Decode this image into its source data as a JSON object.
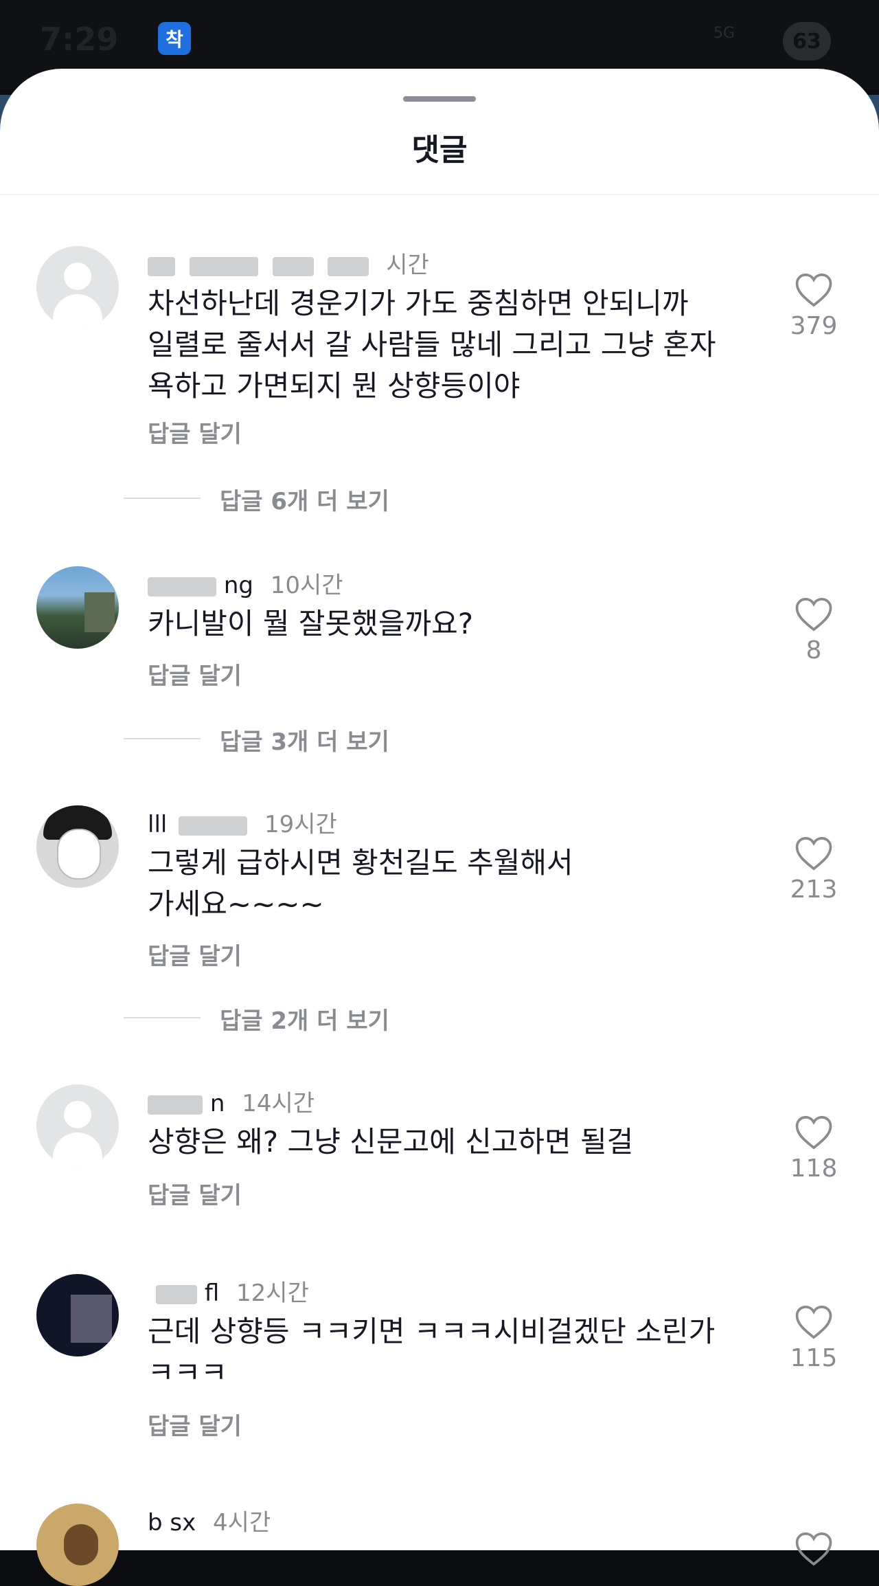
{
  "status_bar": {
    "time": "7:29",
    "notif_badge": "착",
    "network": "5G",
    "battery": "63"
  },
  "sheet": {
    "title": "댓글"
  },
  "reply_label": "답글 달기",
  "comments": [
    {
      "username_visible": "",
      "time": "시간",
      "text_lines": [
        "차선하난데  경운기가 가도 중침하면 안되니까",
        "일렬로 줄서서 갈 사람들 많네 그리고 그냥 혼자",
        "욕하고 가면되지 뭔 상향등이야"
      ],
      "likes": "379",
      "more_replies": "답글 6개 더 보기",
      "avatar": "default-avatar"
    },
    {
      "username_visible": "ng",
      "time": "10시간",
      "text_lines": [
        "카니발이 뭘 잘못했을까요?"
      ],
      "likes": "8",
      "more_replies": "답글 3개 더 보기",
      "avatar": "sky-photo-avatar"
    },
    {
      "username_visible": "lll",
      "time": "19시간",
      "text_lines": [
        "그렇게 급하시면 황천길도 추월해서",
        "가세요~~~~"
      ],
      "likes": "213",
      "more_replies": "답글 2개 더 보기",
      "avatar": "mask-photo-avatar"
    },
    {
      "username_visible": "n",
      "time": "14시간",
      "text_lines": [
        "상향은 왜? 그냥 신문고에 신고하면 될걸"
      ],
      "likes": "118",
      "more_replies": "",
      "avatar": "default-avatar"
    },
    {
      "username_visible": "fl",
      "time": "12시간",
      "text_lines": [
        "근데 상향등 ㅋㅋ키면 ㅋㅋㅋ시비걸겠단 소린가",
        "ㅋㅋㅋ"
      ],
      "likes": "115",
      "more_replies": "",
      "avatar": "night-photo-avatar"
    },
    {
      "username_visible": "b  sx",
      "time": "4시간",
      "text_lines": [],
      "likes": "",
      "more_replies": "",
      "avatar": "dog-photo-avatar"
    }
  ],
  "colors": {
    "text": "#161823",
    "muted": "#8a8b91",
    "sheet": "#ffffff",
    "status_bg": "#101114"
  }
}
